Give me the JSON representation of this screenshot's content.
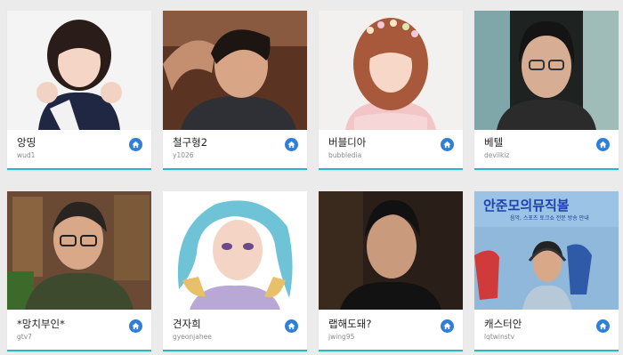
{
  "theme": {
    "accent": "#2f7fd8",
    "underline": "#2fb4c4",
    "background": "#ebebeb"
  },
  "cards": [
    {
      "name": "앙띵",
      "id": "wud1",
      "icon": "home-icon"
    },
    {
      "name": "철구형2",
      "id": "y1026",
      "icon": "home-icon"
    },
    {
      "name": "버블디아",
      "id": "bubbledia",
      "icon": "home-icon"
    },
    {
      "name": "베텔",
      "id": "devilkiz",
      "icon": "home-icon"
    },
    {
      "name": "*망치부인*",
      "id": "gtv7",
      "icon": "home-icon"
    },
    {
      "name": "견자희",
      "id": "gyeonjahee",
      "icon": "home-icon"
    },
    {
      "name": "랩해도돼?",
      "id": "jwing95",
      "icon": "home-icon"
    },
    {
      "name": "캐스터안",
      "id": "lqtwinstv",
      "icon": "home-icon"
    }
  ],
  "thumbnails": {
    "card8_banner": "안준모의뮤직볼",
    "card8_subtitle": "음악, 스포츠 토크쇼 전문 방송 안내"
  }
}
